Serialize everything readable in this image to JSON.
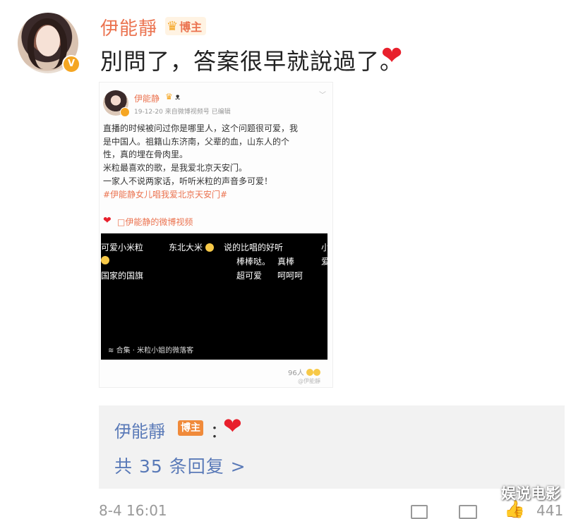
{
  "post": {
    "username": "伊能靜",
    "badge_label": "博主",
    "verified_label": "V",
    "text": "別問了，答案很早就說過了。",
    "heart": "❤"
  },
  "embedded_post": {
    "username": "伊能静",
    "meta": "19-12-20  来自微博视频号  已编辑",
    "lines": [
      "直播的时候被问过你是哪里人，这个问题很可爱，我",
      "是中国人。祖籍山东济南，父辈的血，山东人的个",
      "性，真的埋在骨肉里。",
      "米粒最喜欢的歌，是我爱北京天安门。",
      "一家人不说两家话，听听米粒的声音多可爱！"
    ],
    "hashtag": "#伊能静女儿唱我爱北京天安门#",
    "video_link": "□伊能静的微博视频",
    "video": {
      "c1": "可爱小米粒",
      "c2": "东北大米",
      "c3": "说的比唱的好听",
      "c4": "小",
      "c5": "棒棒哒。",
      "c6": "真棒",
      "c7": "爱",
      "c8": "国家的国旗",
      "c9": "超可爱",
      "c10": "呵呵呵",
      "footer": "合集 · 米粒小姐的微落客"
    },
    "views": "96人",
    "watermark": "@伊能靜"
  },
  "reply": {
    "name": "伊能靜",
    "badge_label": "博主",
    "colon": "：",
    "count_label": "共 35 条回复 >"
  },
  "bottom": {
    "time": "8-4 16:01",
    "like_count": "441"
  },
  "site_watermark": "娱说电影"
}
